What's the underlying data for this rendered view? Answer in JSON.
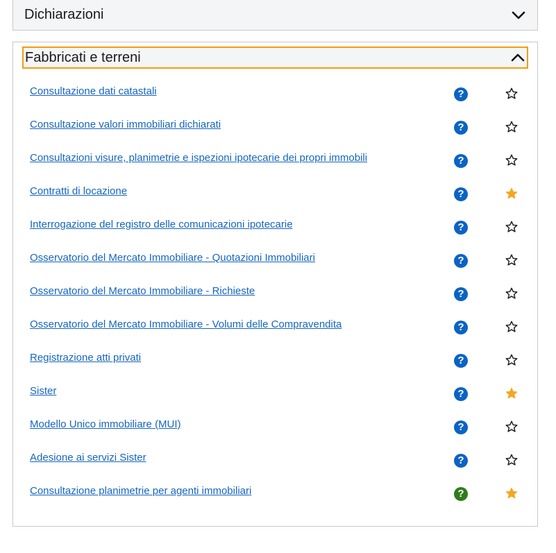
{
  "sections": [
    {
      "title": "Dichiarazioni",
      "state": "collapsed"
    },
    {
      "title": "Fabbricati e terreni",
      "state": "expanded"
    }
  ],
  "colors": {
    "link": "#1565c0",
    "help": "#0b63c4",
    "star_filled": "#f5a623",
    "focus": "#f39c12",
    "highlight": "#ffff00"
  },
  "items": [
    {
      "label": "Consultazione dati catastali",
      "favorite": false
    },
    {
      "label": "Consultazione valori immobiliari dichiarati",
      "favorite": false
    },
    {
      "label": "Consultazioni visure, planimetrie e ispezioni ipotecarie dei propri immobili",
      "favorite": false
    },
    {
      "label": "Contratti di locazione",
      "favorite": true
    },
    {
      "label": "Interrogazione del registro delle comunicazioni ipotecarie",
      "favorite": false
    },
    {
      "label": "Osservatorio del Mercato Immobiliare - Quotazioni Immobiliari",
      "favorite": false
    },
    {
      "label": "Osservatorio del Mercato Immobiliare - Richieste",
      "favorite": false
    },
    {
      "label": "Osservatorio del Mercato Immobiliare - Volumi delle Compravendita",
      "favorite": false
    },
    {
      "label": "Registrazione atti privati",
      "favorite": false
    },
    {
      "label": "Sister",
      "favorite": true
    },
    {
      "label": "Modello Unico immobiliare (MUI)",
      "favorite": false
    },
    {
      "label": "Adesione ai servizi Sister",
      "favorite": false
    },
    {
      "label": "Consultazione planimetrie per agenti immobiliari",
      "favorite": true,
      "highlighted": true
    }
  ],
  "help_glyph": "?"
}
